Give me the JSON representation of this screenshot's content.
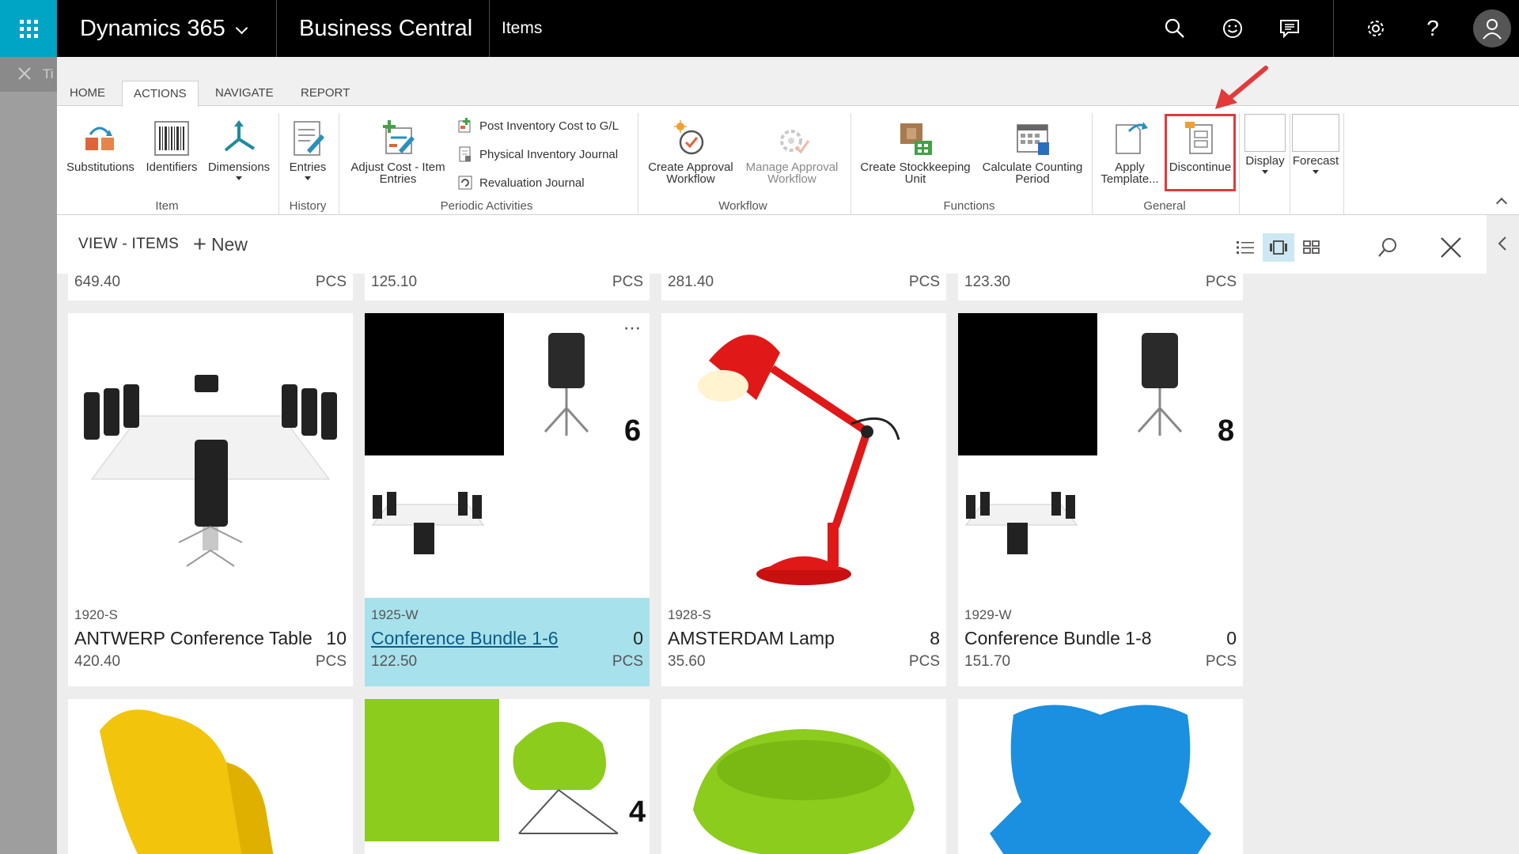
{
  "topbar": {
    "brand": "Dynamics 365",
    "product": "Business Central",
    "page_name": "Items"
  },
  "left_panel": {
    "partial_text": "Ti"
  },
  "ribbon": {
    "tabs": [
      "HOME",
      "ACTIONS",
      "NAVIGATE",
      "REPORT"
    ],
    "active_tab": "ACTIONS",
    "groups": {
      "item": {
        "label": "Item",
        "buttons": [
          "Substitutions",
          "Identifiers",
          "Dimensions"
        ]
      },
      "history": {
        "label": "History",
        "buttons": [
          "Entries"
        ]
      },
      "periodic": {
        "label": "Periodic Activities",
        "adjust_cost_line1": "Adjust Cost - Item",
        "adjust_cost_line2": "Entries",
        "small_buttons": [
          "Post Inventory Cost to G/L",
          "Physical Inventory Journal",
          "Revaluation Journal"
        ]
      },
      "workflow": {
        "label": "Workflow",
        "create_line1": "Create Approval",
        "create_line2": "Workflow",
        "manage_line1": "Manage Approval",
        "manage_line2": "Workflow"
      },
      "functions": {
        "label": "Functions",
        "stockkeeping_line1": "Create Stockkeeping",
        "stockkeeping_line2": "Unit",
        "counting_line1": "Calculate Counting",
        "counting_line2": "Period"
      },
      "general": {
        "label": "General",
        "apply_line1": "Apply",
        "apply_line2": "Template...",
        "discontinue": "Discontinue",
        "display": "Display",
        "forecast": "Forecast"
      }
    }
  },
  "view": {
    "title": "VIEW - ITEMS",
    "new_label": "New"
  },
  "top_row": [
    {
      "price": "649.40",
      "unit": "PCS"
    },
    {
      "price": "125.10",
      "unit": "PCS"
    },
    {
      "price": "281.40",
      "unit": "PCS"
    },
    {
      "price": "123.30",
      "unit": "PCS"
    }
  ],
  "tiles": [
    {
      "code": "1920-S",
      "name": "ANTWERP Conference Table",
      "qty": "10",
      "price": "420.40",
      "unit": "PCS"
    },
    {
      "code": "1925-W",
      "name": "Conference Bundle 1-6",
      "qty": "0",
      "price": "122.50",
      "unit": "PCS",
      "badge": "6"
    },
    {
      "code": "1928-S",
      "name": "AMSTERDAM Lamp",
      "qty": "8",
      "price": "35.60",
      "unit": "PCS"
    },
    {
      "code": "1929-W",
      "name": "Conference Bundle 1-8",
      "qty": "0",
      "price": "151.70",
      "unit": "PCS",
      "badge": "8"
    }
  ],
  "bottom_row": {
    "badge": "4"
  },
  "colors": {
    "accent": "#00a4c4",
    "selected_tile": "#a7e2ec",
    "highlight": "#e23a3a",
    "chair_yellow": "#f2c40c",
    "chair_green": "#8ccc1c",
    "chair_blue": "#1b8fe0",
    "lamp_red": "#e01818"
  }
}
